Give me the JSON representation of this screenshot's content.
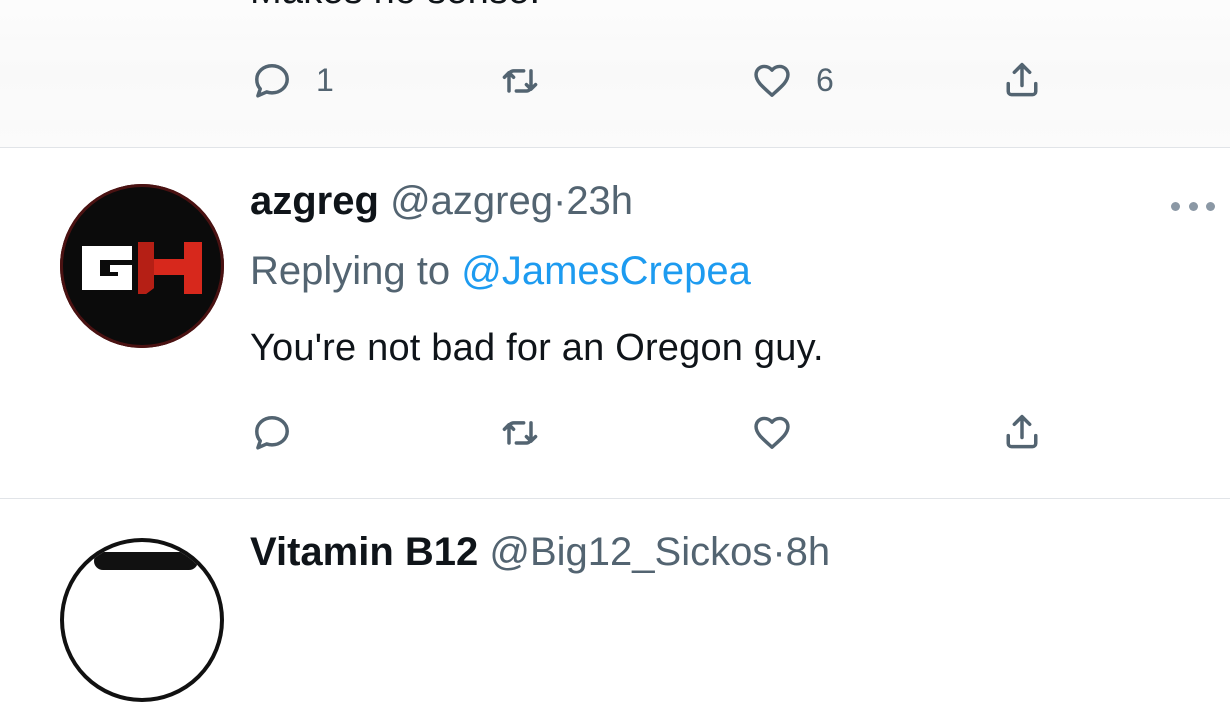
{
  "previous_tweet": {
    "text": "Makes no sense.",
    "actions": {
      "reply_count": "1",
      "retweet_count": "",
      "like_count": "6"
    }
  },
  "tweet": {
    "display_name": "azgreg",
    "handle": "@azgreg",
    "separator": "·",
    "timestamp": "23h",
    "replying_prefix": "Replying to",
    "replying_to": "@JamesCrepea",
    "text": "You're not bad for an Oregon guy.",
    "avatar": {
      "letters": "GH",
      "colors": {
        "background": "#0b0b0b",
        "g": "#ffffff",
        "h": "#d7281c",
        "ring": "#4a1212"
      }
    },
    "actions": {
      "reply_count": "",
      "retweet_count": "",
      "like_count": ""
    }
  },
  "next_tweet": {
    "display_name": "Vitamin B12",
    "handle": "@Big12_Sickos",
    "separator": "·",
    "timestamp": "8h"
  },
  "icons": {
    "reply": "reply-icon",
    "retweet": "retweet-icon",
    "like": "heart-icon",
    "share": "share-icon",
    "more": "more-options-icon"
  },
  "colors": {
    "text_primary": "#0f1419",
    "text_secondary": "#536471",
    "link": "#1d9bf0",
    "divider": "#e1e4e8"
  }
}
